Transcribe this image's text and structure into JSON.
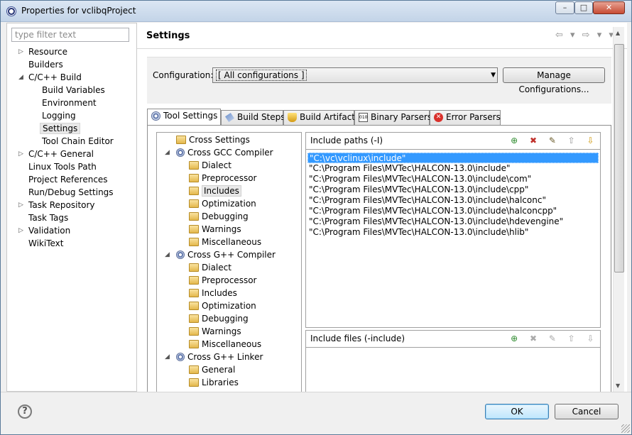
{
  "window": {
    "title": "Properties for vclibqProject",
    "minimize": "–",
    "maximize": "□",
    "close": "✕"
  },
  "filter": {
    "placeholder": "type filter text"
  },
  "nav": {
    "items": [
      {
        "label": "Resource",
        "twisty": "▷"
      },
      {
        "label": "Builders",
        "twisty": ""
      },
      {
        "label": "C/C++ Build",
        "twisty": "◢"
      },
      {
        "label": "Build Variables",
        "twisty": ""
      },
      {
        "label": "Environment",
        "twisty": ""
      },
      {
        "label": "Logging",
        "twisty": ""
      },
      {
        "label": "Settings",
        "twisty": ""
      },
      {
        "label": "Tool Chain Editor",
        "twisty": ""
      },
      {
        "label": "C/C++ General",
        "twisty": "▷"
      },
      {
        "label": "Linux Tools Path",
        "twisty": ""
      },
      {
        "label": "Project References",
        "twisty": ""
      },
      {
        "label": "Run/Debug Settings",
        "twisty": ""
      },
      {
        "label": "Task Repository",
        "twisty": "▷"
      },
      {
        "label": "Task Tags",
        "twisty": ""
      },
      {
        "label": "Validation",
        "twisty": "▷"
      },
      {
        "label": "WikiText",
        "twisty": ""
      }
    ],
    "selected": "Settings"
  },
  "page": {
    "title": "Settings",
    "nav_arrows": "⇦ ▾ ⇨ ▾ ▾"
  },
  "config": {
    "label": "Configuration:",
    "value": "[ All configurations ]",
    "manage_button": "Manage Configurations..."
  },
  "tabs": [
    {
      "label": "Tool Settings",
      "icon": "tool-settings-icon",
      "active": true
    },
    {
      "label": "Build Steps",
      "icon": "build-steps-icon",
      "active": false
    },
    {
      "label": "Build Artifact",
      "icon": "build-artifact-icon",
      "active": false
    },
    {
      "label": "Binary Parsers",
      "icon": "binary-parsers-icon",
      "active": false
    },
    {
      "label": "Error Parsers",
      "icon": "error-parsers-icon",
      "active": false
    }
  ],
  "tool_tree": [
    {
      "label": "Cross Settings",
      "twisty": "",
      "kind": "folder",
      "level": 1
    },
    {
      "label": "Cross GCC Compiler",
      "twisty": "◢",
      "kind": "gear",
      "level": 0
    },
    {
      "label": "Dialect",
      "twisty": "",
      "kind": "folder",
      "level": 2
    },
    {
      "label": "Preprocessor",
      "twisty": "",
      "kind": "folder",
      "level": 2
    },
    {
      "label": "Includes",
      "twisty": "",
      "kind": "folder",
      "level": 2
    },
    {
      "label": "Optimization",
      "twisty": "",
      "kind": "folder",
      "level": 2
    },
    {
      "label": "Debugging",
      "twisty": "",
      "kind": "folder",
      "level": 2
    },
    {
      "label": "Warnings",
      "twisty": "",
      "kind": "folder",
      "level": 2
    },
    {
      "label": "Miscellaneous",
      "twisty": "",
      "kind": "folder",
      "level": 2
    },
    {
      "label": "Cross G++ Compiler",
      "twisty": "◢",
      "kind": "gear",
      "level": 0
    },
    {
      "label": "Dialect",
      "twisty": "",
      "kind": "folder",
      "level": 2
    },
    {
      "label": "Preprocessor",
      "twisty": "",
      "kind": "folder",
      "level": 2
    },
    {
      "label": "Includes",
      "twisty": "",
      "kind": "folder",
      "level": 2
    },
    {
      "label": "Optimization",
      "twisty": "",
      "kind": "folder",
      "level": 2
    },
    {
      "label": "Debugging",
      "twisty": "",
      "kind": "folder",
      "level": 2
    },
    {
      "label": "Warnings",
      "twisty": "",
      "kind": "folder",
      "level": 2
    },
    {
      "label": "Miscellaneous",
      "twisty": "",
      "kind": "folder",
      "level": 2
    },
    {
      "label": "Cross G++ Linker",
      "twisty": "◢",
      "kind": "gear",
      "level": 0
    },
    {
      "label": "General",
      "twisty": "",
      "kind": "folder",
      "level": 2
    },
    {
      "label": "Libraries",
      "twisty": "",
      "kind": "folder",
      "level": 2
    }
  ],
  "include_paths": {
    "title": "Include paths (-I)",
    "items": [
      "\"C:\\vc\\vclinux\\include\"",
      "\"C:\\Program Files\\MVTec\\HALCON-13.0\\include\"",
      "\"C:\\Program Files\\MVTec\\HALCON-13.0\\include\\com\"",
      "\"C:\\Program Files\\MVTec\\HALCON-13.0\\include\\cpp\"",
      "\"C:\\Program Files\\MVTec\\HALCON-13.0\\include\\halconc\"",
      "\"C:\\Program Files\\MVTec\\HALCON-13.0\\include\\halconcpp\"",
      "\"C:\\Program Files\\MVTec\\HALCON-13.0\\include\\hdevengine\"",
      "\"C:\\Program Files\\MVTec\\HALCON-13.0\\include\\hlib\""
    ]
  },
  "include_files": {
    "title": "Include files (-include)",
    "items": []
  },
  "panel_icons": {
    "add": "⊕",
    "delete": "✖",
    "edit": "✎",
    "up": "⇧",
    "down": "⇩"
  },
  "buttons": {
    "help": "?",
    "ok": "OK",
    "cancel": "Cancel"
  },
  "colors": {
    "selection": "#3399ff",
    "titlebar": "#c3d4e8",
    "close": "#c74b33"
  }
}
